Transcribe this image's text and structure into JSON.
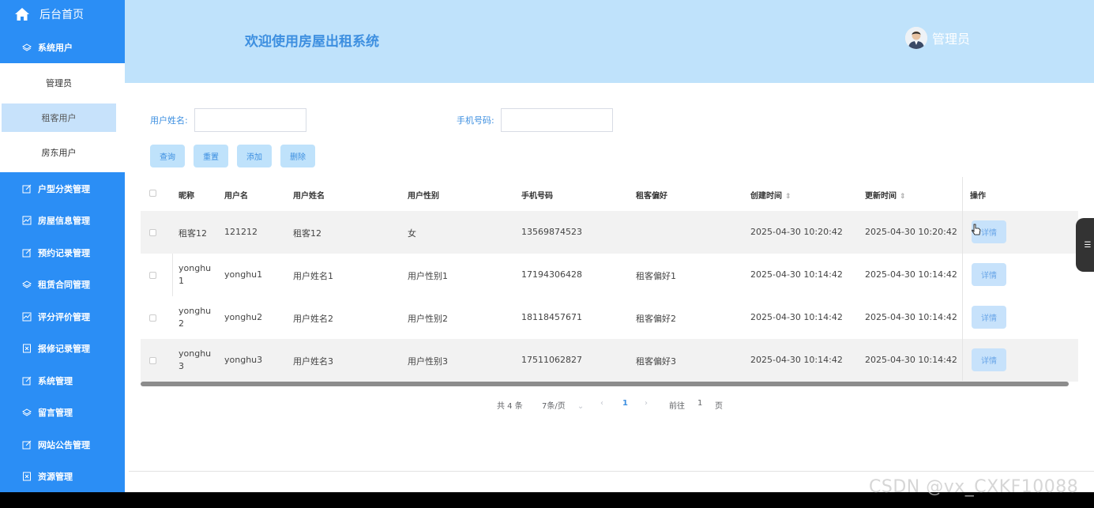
{
  "sidebar": {
    "home": "后台首页",
    "system_users": "系统用户",
    "sub_items": [
      "管理员",
      "租客用户",
      "房东用户"
    ],
    "menus": [
      "户型分类管理",
      "房屋信息管理",
      "预约记录管理",
      "租赁合同管理",
      "评分评价管理",
      "报修记录管理",
      "系统管理",
      "留言管理",
      "网站公告管理",
      "资源管理"
    ]
  },
  "header": {
    "title": "欢迎使用房屋出租系统",
    "user": "管理员"
  },
  "search": {
    "name_label": "用户姓名:",
    "phone_label": "手机号码:",
    "buttons": {
      "query": "查询",
      "reset": "重置",
      "add": "添加",
      "delete": "删除"
    }
  },
  "table": {
    "headers": {
      "nickname": "昵称",
      "username": "用户名",
      "realname": "用户姓名",
      "gender": "用户性别",
      "phone": "手机号码",
      "preference": "租客偏好",
      "created": "创建时间",
      "updated": "更新时间",
      "action": "操作"
    },
    "detail_label": "详情",
    "rows": [
      {
        "nickname": "租客12",
        "username": "121212",
        "realname": "租客12",
        "gender": "女",
        "phone": "13569874523",
        "preference": "",
        "created": "2025-04-30 10:20:42",
        "updated": "2025-04-30 10:20:42"
      },
      {
        "nickname": "yonghu1",
        "username": "yonghu1",
        "realname": "用户姓名1",
        "gender": "用户性别1",
        "phone": "17194306428",
        "preference": "租客偏好1",
        "created": "2025-04-30 10:14:42",
        "updated": "2025-04-30 10:14:42"
      },
      {
        "nickname": "yonghu2",
        "username": "yonghu2",
        "realname": "用户姓名2",
        "gender": "用户性别2",
        "phone": "18118457671",
        "preference": "租客偏好2",
        "created": "2025-04-30 10:14:42",
        "updated": "2025-04-30 10:14:42"
      },
      {
        "nickname": "yonghu3",
        "username": "yonghu3",
        "realname": "用户姓名3",
        "gender": "用户性别3",
        "phone": "17511062827",
        "preference": "租客偏好3",
        "created": "2025-04-30 10:14:42",
        "updated": "2025-04-30 10:14:42"
      }
    ]
  },
  "pagination": {
    "total": "共 4 条",
    "page_size": "7条/页",
    "current": "1",
    "goto_prefix": "前往",
    "goto_value": "1",
    "goto_suffix": "页"
  },
  "watermark": "CSDN @vx_CXKF10088",
  "colors": {
    "sidebar": "#2b8ef5",
    "header": "#bfe2fb",
    "accent": "#3d8fe0"
  }
}
